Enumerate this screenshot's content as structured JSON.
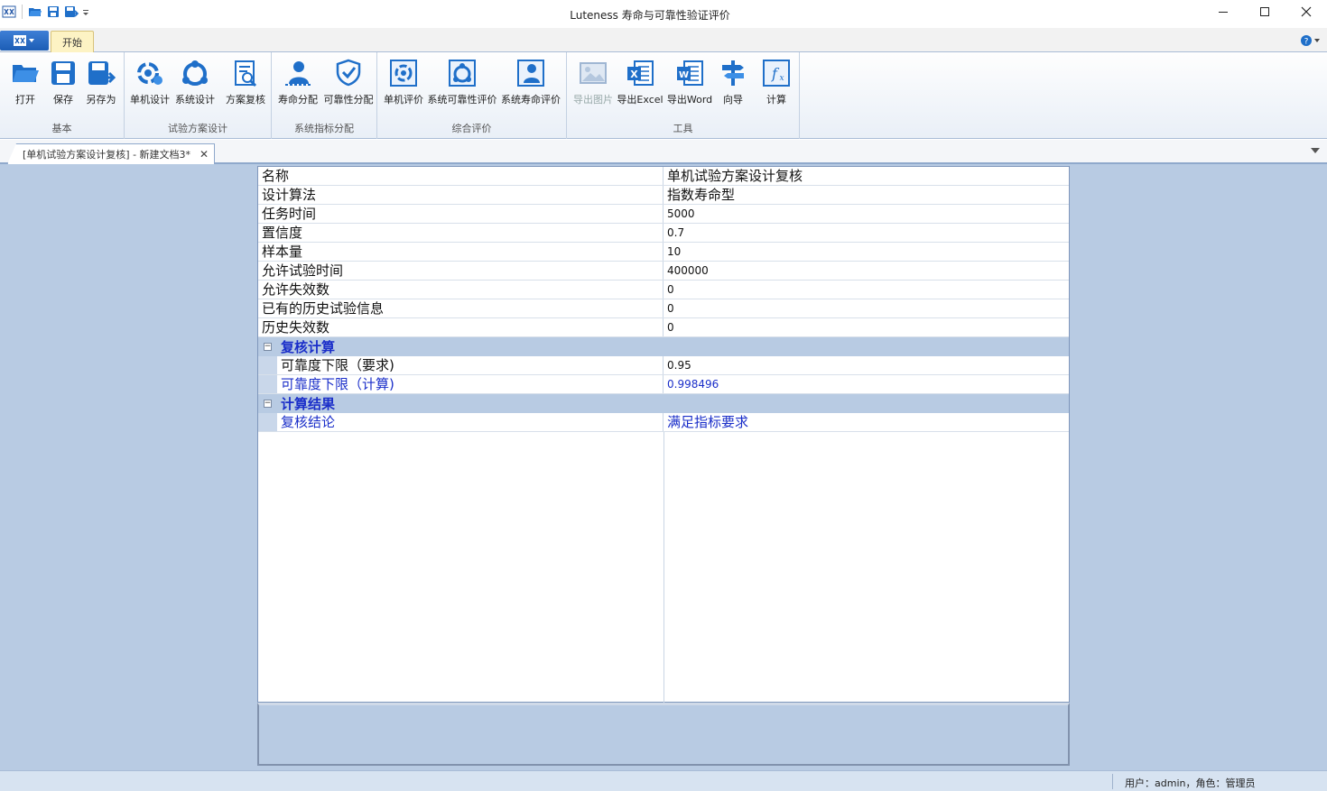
{
  "window": {
    "title": "Luteness 寿命与可靠性验证评价"
  },
  "ribbon": {
    "tabs": [
      {
        "label": "开始"
      }
    ],
    "groups": [
      {
        "label": "基本",
        "buttons": [
          {
            "label": "打开"
          },
          {
            "label": "保存"
          },
          {
            "label": "另存为"
          }
        ]
      },
      {
        "label": "试验方案设计",
        "buttons": [
          {
            "label": "单机设计"
          },
          {
            "label": "系统设计"
          },
          {
            "label": "方案复核"
          }
        ]
      },
      {
        "label": "系统指标分配",
        "buttons": [
          {
            "label": "寿命分配"
          },
          {
            "label": "可靠性分配"
          }
        ]
      },
      {
        "label": "综合评价",
        "buttons": [
          {
            "label": "单机评价"
          },
          {
            "label": "系统可靠性评价"
          },
          {
            "label": "系统寿命评价"
          }
        ]
      },
      {
        "label": "工具",
        "buttons": [
          {
            "label": "导出图片"
          },
          {
            "label": "导出Excel"
          },
          {
            "label": "导出Word"
          },
          {
            "label": "向导"
          },
          {
            "label": "计算"
          }
        ]
      }
    ]
  },
  "document_tab": {
    "label": "[单机试验方案设计复核] - 新建文档3*"
  },
  "grid": {
    "rows": [
      {
        "key": "名称",
        "value": "单机试验方案设计复核"
      },
      {
        "key": "设计算法",
        "value": "指数寿命型"
      },
      {
        "key": "任务时间",
        "value": "5000"
      },
      {
        "key": "置信度",
        "value": "0.7"
      },
      {
        "key": "样本量",
        "value": "10"
      },
      {
        "key": "允许试验时间",
        "value": "400000"
      },
      {
        "key": "允许失效数",
        "value": "0"
      },
      {
        "key": "已有的历史试验信息",
        "value": "0"
      },
      {
        "key": "历史失效数",
        "value": "0"
      }
    ],
    "categories": [
      {
        "title": "复核计算",
        "toggle": "−",
        "rows": [
          {
            "key": "可靠度下限（要求)",
            "value": "0.95"
          },
          {
            "key": "可靠度下限（计算)",
            "value": "0.998496"
          }
        ]
      },
      {
        "title": "计算结果",
        "toggle": "−",
        "rows": [
          {
            "key": "复核结论",
            "value": "满足指标要求"
          }
        ]
      }
    ]
  },
  "statusbar": {
    "text": "用户：admin，角色：管理员"
  },
  "colors": {
    "accent_blue": "#1a2ec9",
    "panel_bg": "#b8cbe3",
    "tab_active": "#fdf3c4"
  }
}
